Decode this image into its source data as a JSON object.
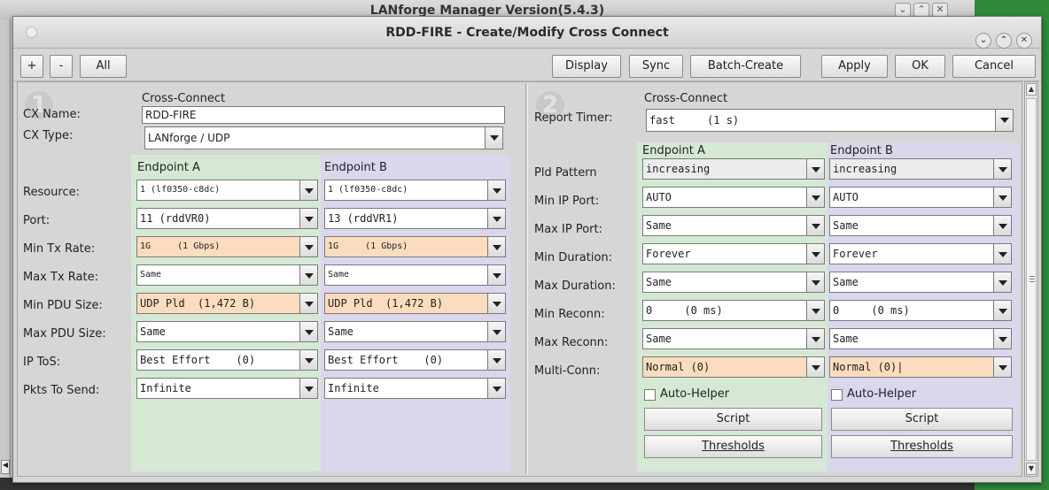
{
  "background": {
    "title": "LANforge Manager   Version(5.4.3)"
  },
  "dialog": {
    "title": "RDD-FIRE - Create/Modify Cross Connect",
    "window_buttons": [
      "⌄",
      "⌃",
      "✕"
    ]
  },
  "toolbar": {
    "plus": "+",
    "minus": "-",
    "all": "All",
    "display": "Display",
    "sync": "Sync",
    "batch_create": "Batch-Create",
    "apply": "Apply",
    "ok": "OK",
    "cancel": "Cancel"
  },
  "left": {
    "number": "1",
    "cross_connect_label": "Cross-Connect",
    "cx_name_label": "CX Name:",
    "cx_name_value": "RDD-FIRE",
    "cx_type_label": "CX Type:",
    "cx_type_value": "LANforge / UDP",
    "endpoint_a": "Endpoint A",
    "endpoint_b": "Endpoint B",
    "rows": [
      {
        "label": "Resource:",
        "a": "1 (lf0350-c8dc)",
        "b": "1 (lf0350-c8dc)"
      },
      {
        "label": "Port:",
        "a": "11 (rddVR0)",
        "b": "13 (rddVR1)"
      },
      {
        "label": "Min Tx Rate:",
        "a": "1G     (1 Gbps)",
        "b": "1G     (1 Gbps)"
      },
      {
        "label": "Max Tx Rate:",
        "a": "Same",
        "b": "Same"
      },
      {
        "label": "Min PDU Size:",
        "a": "UDP Pld  (1,472 B)",
        "b": "UDP Pld  (1,472 B)"
      },
      {
        "label": "Max PDU Size:",
        "a": "Same",
        "b": "Same"
      },
      {
        "label": "IP ToS:",
        "a": "Best Effort    (0)",
        "b": "Best Effort    (0)"
      },
      {
        "label": "Pkts To Send:",
        "a": "Infinite",
        "b": "Infinite"
      }
    ]
  },
  "right": {
    "number": "2",
    "cross_connect_label": "Cross-Connect",
    "report_timer_label": "Report Timer:",
    "report_timer_value": "fast     (1 s)",
    "endpoint_a": "Endpoint A",
    "endpoint_b": "Endpoint B",
    "rows": [
      {
        "label": "Pld Pattern",
        "a": "increasing",
        "b": "increasing"
      },
      {
        "label": "Min IP Port:",
        "a": "AUTO",
        "b": "AUTO"
      },
      {
        "label": "Max IP Port:",
        "a": "Same",
        "b": "Same"
      },
      {
        "label": "Min Duration:",
        "a": "Forever",
        "b": "Forever"
      },
      {
        "label": "Max Duration:",
        "a": "Same",
        "b": "Same"
      },
      {
        "label": "Min Reconn:",
        "a": "0     (0 ms)",
        "b": "0     (0 ms)"
      },
      {
        "label": "Max Reconn:",
        "a": "Same",
        "b": "Same"
      },
      {
        "label": "Multi-Conn:",
        "a": "Normal (0)",
        "b": "Normal (0)|"
      }
    ],
    "auto_helper": "Auto-Helper",
    "script": "Script",
    "thresholds": "Thresholds"
  },
  "colors": {
    "endpoint_a_bg": "#d5e8d4",
    "endpoint_b_bg": "#dad6ec",
    "highlight": "#fbdcbe"
  }
}
